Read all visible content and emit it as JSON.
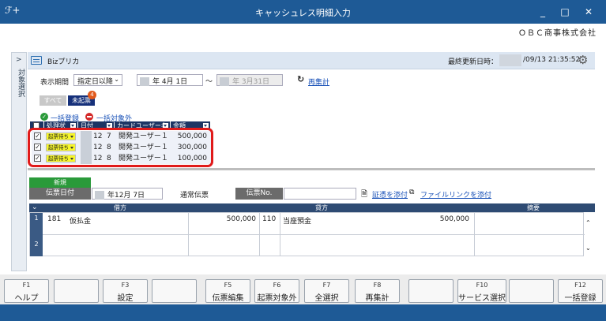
{
  "window": {
    "title": "キャッシュレス明細入力",
    "logo": "ℱ+",
    "min": "_",
    "max": "□",
    "close": "✕"
  },
  "company": "ＯＢＣ商事株式会社",
  "side_panel": {
    "arrow": ">",
    "label": "対象選択"
  },
  "header": {
    "name": "Bizプリカ",
    "last_updated_label": "最終更新日時：",
    "last_updated_value": "/09/13 21:35:52"
  },
  "filter": {
    "period_label": "表示期間",
    "period_select": "指定日以降",
    "from_date": "年  4月  1日",
    "tilde": "～",
    "to_date": "年  3月31日",
    "recalc_link": "再集計"
  },
  "tabs": {
    "all": "すべて",
    "unposted": "未起票",
    "unposted_count": "4"
  },
  "bulk": {
    "register": "一括登録",
    "exclude": "一括対象外"
  },
  "list": {
    "columns": [
      "処理状",
      "日付",
      "カードユーザー名",
      "金額"
    ],
    "rows": [
      {
        "status": "起票待ち",
        "month": "12",
        "day": "7",
        "user": "開発ユーザー１",
        "amount": "500,000"
      },
      {
        "status": "起票待ち",
        "month": "12",
        "day": "8",
        "user": "開発ユーザー１",
        "amount": "300,000"
      },
      {
        "status": "起票待ち",
        "month": "12",
        "day": "8",
        "user": "開発ユーザー１",
        "amount": "100,000"
      }
    ]
  },
  "voucher": {
    "new_label": "新規",
    "date_label": "伝票日付",
    "date_value": "年12月  7日",
    "type_value": "通常伝票",
    "no_label": "伝票No.",
    "attach_link": "証憑を添付",
    "filelink": "ファイルリンクを添付"
  },
  "journal": {
    "debit_header": "借方",
    "credit_header": "貸方",
    "memo_header": "摘要",
    "rows": [
      {
        "num": "1",
        "debit_code": "181",
        "debit_name": "仮払金",
        "debit_amount": "500,000",
        "credit_code": "110",
        "credit_name": "当座預金",
        "credit_amount": "500,000"
      },
      {
        "num": "2"
      }
    ]
  },
  "fkeys": [
    {
      "key": "F1",
      "label": "ヘルプ"
    },
    {
      "key": "",
      "label": ""
    },
    {
      "key": "F3",
      "label": "設定"
    },
    {
      "key": "",
      "label": ""
    },
    {
      "key": "F5",
      "label": "伝票編集"
    },
    {
      "key": "F6",
      "label": "起票対象外"
    },
    {
      "key": "F7",
      "label": "全選択"
    },
    {
      "key": "F8",
      "label": "再集計"
    },
    {
      "key": "",
      "label": ""
    },
    {
      "key": "F10",
      "label": "サービス選択"
    },
    {
      "key": "",
      "label": ""
    },
    {
      "key": "F12",
      "label": "一括登録"
    }
  ],
  "colors": {
    "titlebar": "#1e5a96",
    "header_dark": "#1c3564",
    "highlight_red": "#e01a1a",
    "status_yellow": "#f7f72a",
    "new_green": "#2a9a3a"
  }
}
